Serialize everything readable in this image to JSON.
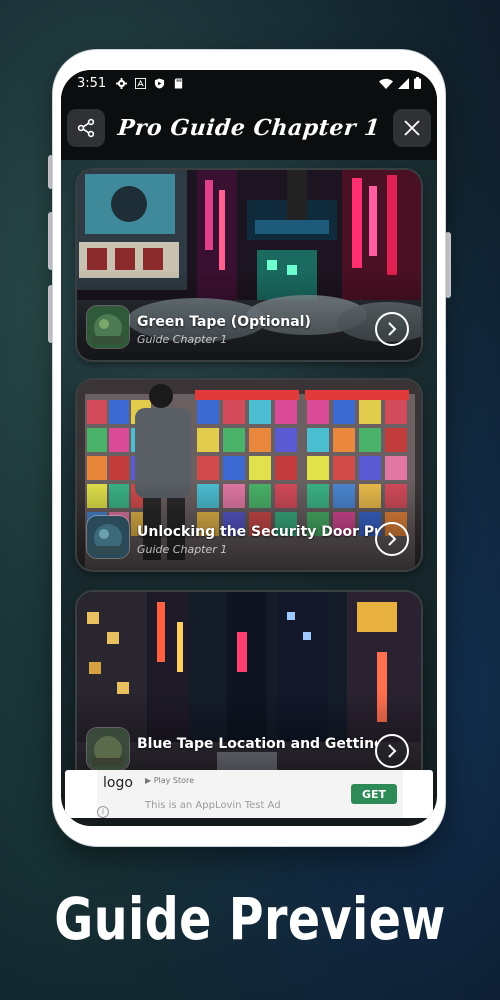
{
  "status_bar": {
    "time": "3:51"
  },
  "header": {
    "title": "Pro Guide Chapter 1"
  },
  "cards": [
    {
      "title": "Green Tape (Optional)",
      "subtitle": "Guide Chapter 1"
    },
    {
      "title": "Unlocking the Security Door Puz",
      "subtitle": "Guide Chapter 1"
    },
    {
      "title": "Blue Tape Location and Getting ...",
      "subtitle": ""
    }
  ],
  "ad": {
    "logo_alt": "logo",
    "store": "Play Store",
    "text": "This is an AppLovin Test Ad",
    "cta": "GET",
    "cta_color": "#2e8b57"
  },
  "caption": "Guide Preview",
  "icons": [
    "share-icon",
    "close-icon",
    "chevron-right-icon",
    "wifi-icon",
    "signal-icon",
    "battery-icon",
    "gear-icon",
    "play-protect-icon",
    "sd-card-icon",
    "font-icon",
    "play-store-icon",
    "info-icon"
  ]
}
